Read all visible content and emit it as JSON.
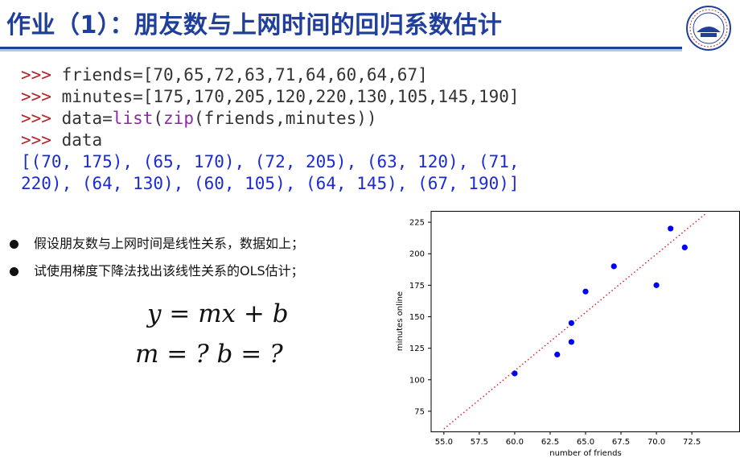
{
  "slide": {
    "title": "作业（1）：朋友数与上网时间的回归系数估计",
    "logo_icon": "university-emblem-icon"
  },
  "code": {
    "prompt": ">>>",
    "line1": " friends=[70,65,72,63,71,64,60,64,67]",
    "line2": " minutes=[175,170,205,120,220,130,105,145,190]",
    "line3_a": " data=",
    "line3_list": "list",
    "line3_b": "(",
    "line3_zip": "zip",
    "line3_c": "(friends,minutes))",
    "line4": " data",
    "output1": "[(70, 175), (65, 170), (72, 205), (63, 120), (71,",
    "output2": "220), (64, 130), (60, 105), (64, 145), (67, 190)]"
  },
  "bullets": [
    "假设朋友数与上网时间是线性关系，数据如上；",
    "试使用梯度下降法找出该线性关系的OLS估计；"
  ],
  "formulas": {
    "line1": "y = mx + b",
    "line2": "m = ?    b = ?"
  },
  "colors": {
    "title": "#1f3f9a",
    "prompt": "#b3252a",
    "builtin": "#8b2aa8",
    "output": "#1b2bd4",
    "points": "#0000ff",
    "trend": "#d62728"
  },
  "chart_data": {
    "type": "scatter",
    "title": "",
    "xlabel": "number of friends",
    "ylabel": "minutes online",
    "xlim": [
      54.1,
      75.9
    ],
    "ylim": [
      59,
      234
    ],
    "x_ticks": [
      "55.0",
      "57.5",
      "60.0",
      "62.5",
      "65.0",
      "67.5",
      "70.0",
      "72.5"
    ],
    "y_ticks": [
      "75",
      "100",
      "125",
      "150",
      "175",
      "200",
      "225"
    ],
    "series": [
      {
        "x": [
          70,
          65,
          72,
          63,
          71,
          64,
          60,
          64,
          67
        ],
        "y": [
          175,
          170,
          205,
          120,
          220,
          130,
          105,
          145,
          190
        ]
      }
    ],
    "trend_line": {
      "x": [
        55,
        73.5
      ],
      "y": [
        61,
        232
      ],
      "style": "dotted"
    },
    "grid": false
  }
}
